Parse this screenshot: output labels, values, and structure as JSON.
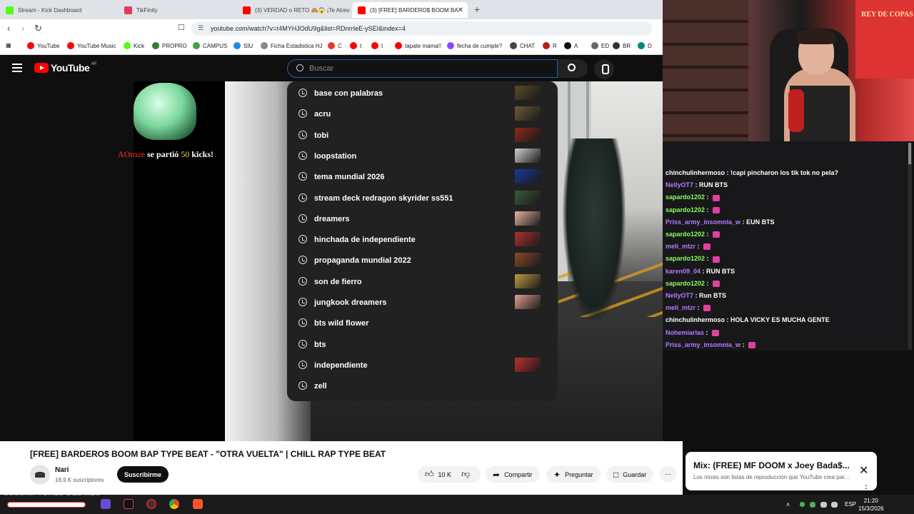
{
  "browser": {
    "tabs": [
      {
        "label": "Stream - Kick Dashboard",
        "color": "#53fc18"
      },
      {
        "label": "TikFinity",
        "color": "#e23b5a"
      },
      {
        "label": "(3) VERDAD o RETO 🙈😱 ¡Te Atreves",
        "color": "#ff0000"
      },
      {
        "label": "(3) [FREE] BARDERO$ BOOM BA",
        "color": "#ff0000"
      }
    ],
    "url": "youtube.com/watch?v=r4MYHJOdU9g&list=RDnrrIeE-ySEI&index=4",
    "bookmarks": [
      {
        "label": "YouTube",
        "color": "#ff0000"
      },
      {
        "label": "YouTube Music",
        "color": "#ff0000"
      },
      {
        "label": "Kick",
        "color": "#53fc18"
      },
      {
        "label": "PROPRO",
        "color": "#2e7d32"
      },
      {
        "label": "CAMPUS",
        "color": "#43a047"
      },
      {
        "label": "SIU",
        "color": "#1e88e5"
      },
      {
        "label": "Ficha Estadistica HJ",
        "color": "#888888"
      },
      {
        "label": "C",
        "color": "#e53935"
      },
      {
        "label": "t",
        "color": "#ff0000"
      },
      {
        "label": "t",
        "color": "#ff0000"
      },
      {
        "label": "tapate mama!!",
        "color": "#ff0000"
      },
      {
        "label": "fecha de cumple?",
        "color": "#9146ff"
      },
      {
        "label": "CHAT",
        "color": "#444444"
      },
      {
        "label": "R",
        "color": "#b71c1c"
      },
      {
        "label": "A",
        "color": "#111111"
      },
      {
        "label": "ED",
        "color": "#666666"
      },
      {
        "label": "BR",
        "color": "#333333"
      },
      {
        "label": "D",
        "color": "#00897b"
      }
    ]
  },
  "youtube": {
    "logo_text": "YouTube",
    "region": "AR",
    "search_placeholder": "Buscar",
    "suggestions": [
      {
        "text": "base con palabras",
        "thumb": "#5a4a2a"
      },
      {
        "text": "acru",
        "thumb": "#6b5a3a"
      },
      {
        "text": "tobi",
        "thumb": "#8a2a1a"
      },
      {
        "text": "loopstation",
        "thumb": "#d0d0d0"
      },
      {
        "text": "tema mundial 2026",
        "thumb": "#1a3a9a"
      },
      {
        "text": "stream deck redragon skyrider ss551",
        "thumb": "#3a5a3a"
      },
      {
        "text": "dreamers",
        "thumb": "#e8b0a0"
      },
      {
        "text": "hinchada de independiente",
        "thumb": "#b03030"
      },
      {
        "text": "propaganda mundial 2022",
        "thumb": "#8a4a2a"
      },
      {
        "text": "son de fierro",
        "thumb": "#c09a40"
      },
      {
        "text": "jungkook dreamers",
        "thumb": "#e0a090"
      },
      {
        "text": "bts wild flower",
        "thumb": ""
      },
      {
        "text": "bts",
        "thumb": ""
      },
      {
        "text": "independiente",
        "thumb": "#c03030"
      },
      {
        "text": "zell",
        "thumb": ""
      }
    ],
    "alert": {
      "user": "AOroze",
      "middle": " se partió ",
      "amount": "50",
      "suffix": " kicks!"
    },
    "video_title": "[FREE] BARDERO$ BOOM BAP TYPE BEAT - \"OTRA VUELTA\" | CHILL RAP TYPE BEAT",
    "channel": "Nari",
    "subscribers": "18,9 K suscriptores",
    "subscribe_label": "Suscribirme",
    "likes": "10 K",
    "share_label": "Compartir",
    "ask_label": "Preguntar",
    "save_label": "Guardar",
    "mix_title": "Mix: (FREE) MF DOOM x Joey Bada$...",
    "mix_subtitle": "Los mixes son listas de reproducción que YouTube crea par..."
  },
  "webcam": {
    "poster_text": "REY DE COPAS"
  },
  "chat": [
    {
      "user": "chinchulinhermoso",
      "color": "#ffffff",
      "msg": "!capi pincharon los tik tok no pela?"
    },
    {
      "user": "NellyOT7",
      "color": "#b57bff",
      "msg": "RUN BTS"
    },
    {
      "user": "sapardo1202",
      "color": "#8cff5a",
      "msg": "",
      "emote": true
    },
    {
      "user": "sapardo1202",
      "color": "#8cff5a",
      "msg": "",
      "emote": true
    },
    {
      "user": "Priss_army_insomnia_w",
      "color": "#b57bff",
      "msg": "EUN BTS"
    },
    {
      "user": "sapardo1202",
      "color": "#8cff5a",
      "msg": "",
      "emote": true
    },
    {
      "user": "meli_mtzr",
      "color": "#b57bff",
      "msg": "",
      "emote": true
    },
    {
      "user": "sapardo1202",
      "color": "#8cff5a",
      "msg": "",
      "emote": true
    },
    {
      "user": "karen09_04",
      "color": "#b57bff",
      "msg": "RUN BTS"
    },
    {
      "user": "sapardo1202",
      "color": "#8cff5a",
      "msg": "",
      "emote": true
    },
    {
      "user": "NellyOT7",
      "color": "#b57bff",
      "msg": "Run BTS"
    },
    {
      "user": "meli_mtzr",
      "color": "#b57bff",
      "msg": "",
      "emote": true
    },
    {
      "user": "chinchulinhermoso",
      "color": "#ffffff",
      "msg": "HOLA VICKY ES MUCHA GENTE"
    },
    {
      "user": "Nohemiarias",
      "color": "#b57bff",
      "msg": "",
      "emote": true
    },
    {
      "user": "Priss_army_insomnia_w",
      "color": "#b57bff",
      "msg": "",
      "emote": true
    }
  ],
  "overlay": {
    "subs_of_month": "SUSCRIPTORES DEL MES"
  },
  "taskbar": {
    "lang": "ESP",
    "time": "21:20",
    "date": "15/3/2026"
  }
}
